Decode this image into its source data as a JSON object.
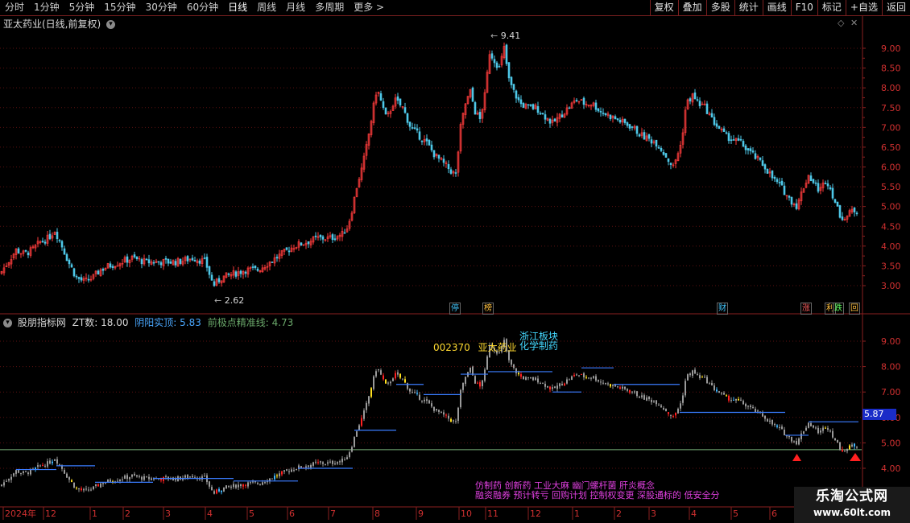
{
  "toolbar": {
    "periods": [
      "分时",
      "1分钟",
      "5分钟",
      "15分钟",
      "30分钟",
      "60分钟",
      "日线",
      "周线",
      "月线",
      "多周期",
      "更多 >"
    ],
    "active_period": "日线",
    "actions": [
      "复权",
      "叠加",
      "多股",
      "统计",
      "画线",
      "F10",
      "标记",
      "+自选",
      "返回"
    ]
  },
  "main_panel": {
    "title": "亚太药业(日线,前复权)",
    "y_ticks": [
      "9.00",
      "8.50",
      "8.00",
      "7.50",
      "7.00",
      "6.50",
      "6.00",
      "5.50",
      "5.00",
      "4.50",
      "4.00",
      "3.50",
      "3.00"
    ],
    "high_label": "9.41",
    "low_label": "2.62",
    "markers": [
      {
        "text": "停",
        "color": "#44c8ff"
      },
      {
        "text": "榜",
        "color": "#ffc040"
      },
      {
        "text": "财",
        "color": "#44c8ff"
      },
      {
        "text": "涨",
        "color": "#ff6060"
      },
      {
        "text": "利",
        "color": "#ffc040"
      },
      {
        "text": "跌",
        "color": "#60ff60"
      },
      {
        "text": "回",
        "color": "#ffc040"
      }
    ]
  },
  "sub_panel": {
    "title": "股朋指标网",
    "zt_label": "ZT数:",
    "zt_value": "18.00",
    "line1_label": "阴阳实顶:",
    "line1_value": "5.83",
    "line2_label": "前极点精准线:",
    "line2_value": "4.73",
    "y_ticks": [
      "9.00",
      "8.00",
      "7.00",
      "6.00",
      "5.00",
      "4.00"
    ],
    "price_tag": "5.87",
    "stock_code": "002370",
    "stock_name": "亚太药业",
    "sector_1": "浙江板块",
    "sector_2": "化学制药",
    "concepts_1": "仿制药 创新药 工业大麻 幽门螺杆菌 肝炎概念",
    "concepts_2": "融资融券 预计转亏 回购计划 控制权变更 深股通标的 低安全分"
  },
  "x_axis": {
    "labels": [
      "2024年",
      "12",
      "1",
      "2",
      "3",
      "4",
      "5",
      "6",
      "7",
      "8",
      "9",
      "10",
      "11",
      "12",
      "1",
      "2",
      "3",
      "4",
      "5",
      "6"
    ]
  },
  "watermark": {
    "line1": "乐淘公式网",
    "line2": "www.60lt.com"
  },
  "chart_data": {
    "type": "candlestick",
    "title": "亚太药业(日线,前复权)",
    "y_range": [
      2.5,
      9.6
    ],
    "high": 9.41,
    "low": 2.62,
    "close_path_approx": [
      [
        0,
        3.3
      ],
      [
        10,
        3.6
      ],
      [
        20,
        3.9
      ],
      [
        30,
        3.8
      ],
      [
        40,
        3.9
      ],
      [
        50,
        4.1
      ],
      [
        60,
        4.2
      ],
      [
        68,
        4.4
      ],
      [
        75,
        4.1
      ],
      [
        85,
        3.6
      ],
      [
        95,
        3.2
      ],
      [
        105,
        3.1
      ],
      [
        115,
        3.2
      ],
      [
        125,
        3.4
      ],
      [
        135,
        3.5
      ],
      [
        150,
        3.6
      ],
      [
        165,
        3.7
      ],
      [
        180,
        3.6
      ],
      [
        200,
        3.6
      ],
      [
        220,
        3.6
      ],
      [
        240,
        3.7
      ],
      [
        255,
        3.6
      ],
      [
        265,
        3.0
      ],
      [
        275,
        3.2
      ],
      [
        290,
        3.3
      ],
      [
        305,
        3.4
      ],
      [
        320,
        3.4
      ],
      [
        335,
        3.6
      ],
      [
        350,
        3.8
      ],
      [
        365,
        4.0
      ],
      [
        380,
        4.1
      ],
      [
        395,
        4.2
      ],
      [
        410,
        4.2
      ],
      [
        425,
        4.3
      ],
      [
        432,
        4.5
      ],
      [
        438,
        5.0
      ],
      [
        444,
        5.6
      ],
      [
        450,
        6.0
      ],
      [
        456,
        6.6
      ],
      [
        462,
        7.3
      ],
      [
        468,
        8.0
      ],
      [
        474,
        7.6
      ],
      [
        480,
        7.2
      ],
      [
        490,
        7.7
      ],
      [
        500,
        7.5
      ],
      [
        510,
        7.0
      ],
      [
        520,
        6.8
      ],
      [
        530,
        6.6
      ],
      [
        540,
        6.3
      ],
      [
        550,
        6.1
      ],
      [
        560,
        5.9
      ],
      [
        566,
        5.8
      ],
      [
        572,
        7.0
      ],
      [
        578,
        7.6
      ],
      [
        584,
        7.9
      ],
      [
        590,
        7.4
      ],
      [
        596,
        7.2
      ],
      [
        602,
        7.8
      ],
      [
        608,
        8.9
      ],
      [
        614,
        8.7
      ],
      [
        620,
        8.5
      ],
      [
        626,
        9.0
      ],
      [
        632,
        8.2
      ],
      [
        638,
        7.9
      ],
      [
        646,
        7.6
      ],
      [
        656,
        7.5
      ],
      [
        666,
        7.5
      ],
      [
        676,
        7.3
      ],
      [
        686,
        7.1
      ],
      [
        696,
        7.3
      ],
      [
        706,
        7.5
      ],
      [
        716,
        7.7
      ],
      [
        726,
        7.6
      ],
      [
        736,
        7.6
      ],
      [
        746,
        7.4
      ],
      [
        756,
        7.3
      ],
      [
        766,
        7.2
      ],
      [
        776,
        7.1
      ],
      [
        786,
        7.0
      ],
      [
        796,
        6.8
      ],
      [
        806,
        6.7
      ],
      [
        816,
        6.6
      ],
      [
        826,
        6.3
      ],
      [
        836,
        6.0
      ],
      [
        846,
        6.6
      ],
      [
        852,
        7.6
      ],
      [
        860,
        7.8
      ],
      [
        868,
        7.6
      ],
      [
        876,
        7.5
      ],
      [
        884,
        7.2
      ],
      [
        892,
        7.0
      ],
      [
        900,
        6.8
      ],
      [
        910,
        6.7
      ],
      [
        920,
        6.6
      ],
      [
        930,
        6.4
      ],
      [
        940,
        6.2
      ],
      [
        950,
        6.0
      ],
      [
        960,
        5.7
      ],
      [
        970,
        5.5
      ],
      [
        980,
        5.2
      ],
      [
        990,
        5.0
      ],
      [
        996,
        5.4
      ],
      [
        1004,
        5.8
      ],
      [
        1010,
        5.6
      ],
      [
        1018,
        5.4
      ],
      [
        1026,
        5.7
      ],
      [
        1034,
        5.3
      ],
      [
        1042,
        4.8
      ],
      [
        1050,
        4.7
      ],
      [
        1058,
        4.9
      ],
      [
        1064,
        4.9
      ]
    ]
  }
}
